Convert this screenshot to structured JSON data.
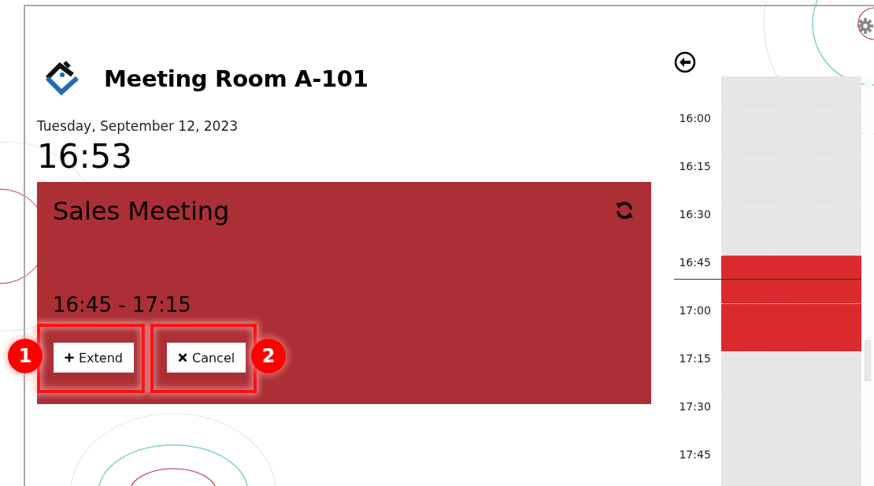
{
  "room": {
    "title": "Meeting Room A-101"
  },
  "date": "Tuesday, September 12, 2023",
  "clock": "16:53",
  "meeting": {
    "title": "Sales Meeting",
    "time_range": "16:45 - 17:15",
    "actions": [
      {
        "kind": "extend",
        "label": "Extend",
        "callout": "1",
        "highlighted": true
      },
      {
        "kind": "cancel",
        "label": "Cancel",
        "callout": "2",
        "highlighted": true
      }
    ]
  },
  "timeline": {
    "slots": [
      {
        "time": "16:00",
        "booked": false,
        "current": false
      },
      {
        "time": "16:15",
        "booked": false,
        "current": false
      },
      {
        "time": "16:30",
        "booked": false,
        "current": false
      },
      {
        "time": "16:45",
        "booked": true,
        "current": true
      },
      {
        "time": "17:00",
        "booked": true,
        "current": false
      },
      {
        "time": "17:15",
        "booked": false,
        "current": false
      },
      {
        "time": "17:30",
        "booked": false,
        "current": false
      },
      {
        "time": "17:45",
        "booked": false,
        "current": false
      }
    ]
  }
}
